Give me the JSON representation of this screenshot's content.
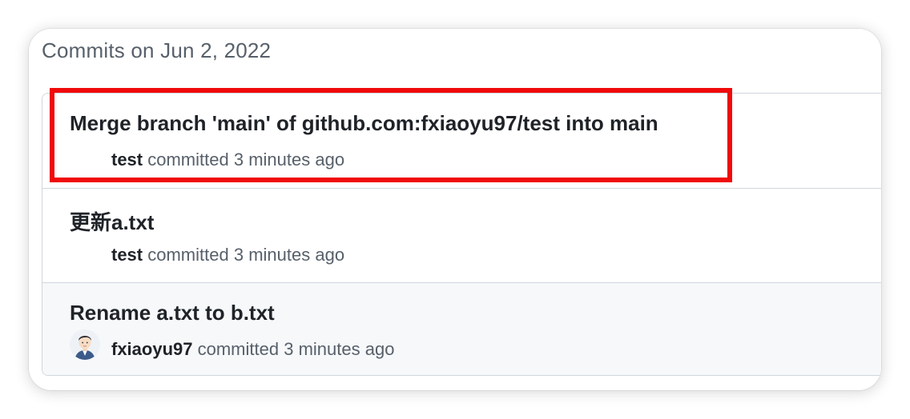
{
  "group": {
    "header": "Commits on Jun 2, 2022"
  },
  "commits": [
    {
      "title": "Merge branch 'main' of github.com:fxiaoyu97/test into main",
      "author": "test",
      "action": "committed",
      "time": "3 minutes ago",
      "has_avatar": false
    },
    {
      "title": "更新a.txt",
      "author": "test",
      "action": "committed",
      "time": "3 minutes ago",
      "has_avatar": false
    },
    {
      "title": "Rename a.txt to b.txt",
      "author": "fxiaoyu97",
      "action": "committed",
      "time": "3 minutes ago",
      "has_avatar": true,
      "avatar_icon": "person-avatar-icon"
    }
  ],
  "colors": {
    "highlight": "#f00a0a",
    "border": "#d0d7de",
    "muted_text": "#57606a",
    "title_text": "#1f2328",
    "hover_row_bg": "#f6f8fa"
  }
}
